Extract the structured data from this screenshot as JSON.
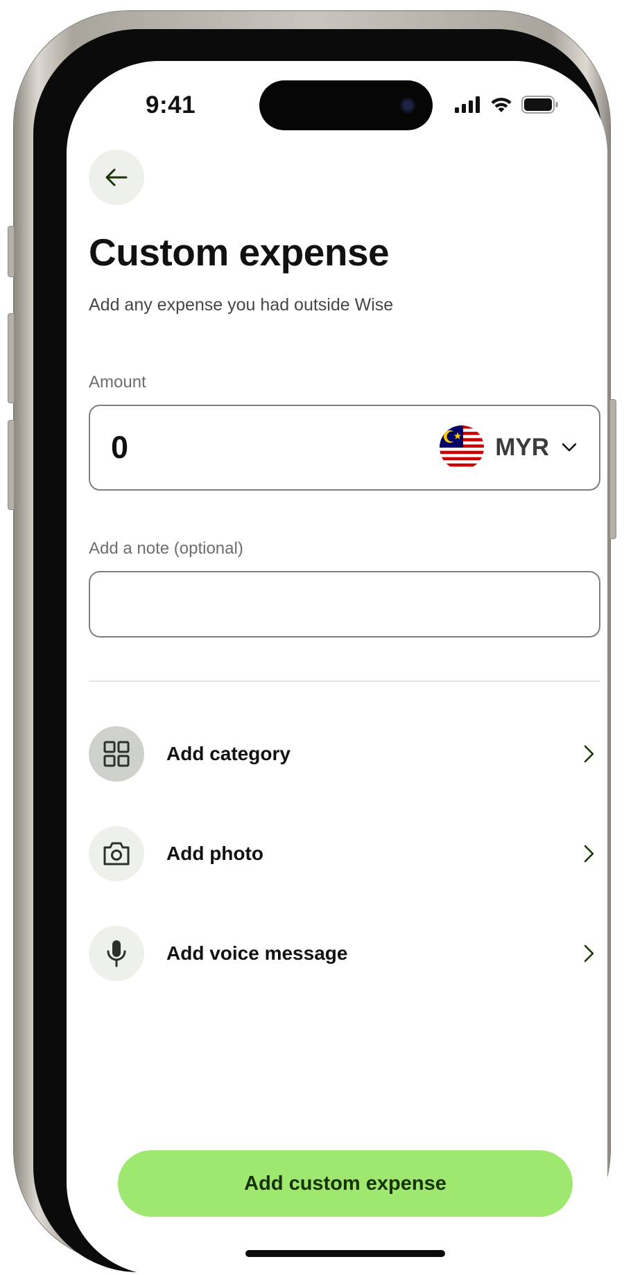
{
  "status_bar": {
    "time": "9:41"
  },
  "header": {
    "back_icon": "arrow-left-icon",
    "title": "Custom expense",
    "subtitle": "Add any expense you had outside Wise"
  },
  "amount": {
    "label": "Amount",
    "value": "0",
    "currency_code": "MYR",
    "currency_flag": "malaysia-flag-icon"
  },
  "note": {
    "label": "Add a note (optional)",
    "value": "",
    "placeholder": ""
  },
  "options": [
    {
      "label": "Add category",
      "icon": "grid-icon",
      "icon_bg": "#cfd1cd"
    },
    {
      "label": "Add photo",
      "icon": "camera-icon",
      "icon_bg": "#eef0ec"
    },
    {
      "label": "Add voice message",
      "icon": "microphone-icon",
      "icon_bg": "#eef0ec"
    }
  ],
  "cta": {
    "label": "Add custom expense"
  },
  "colors": {
    "accent": "#9fe870",
    "accent_text": "#163300",
    "chevron": "#163300"
  }
}
